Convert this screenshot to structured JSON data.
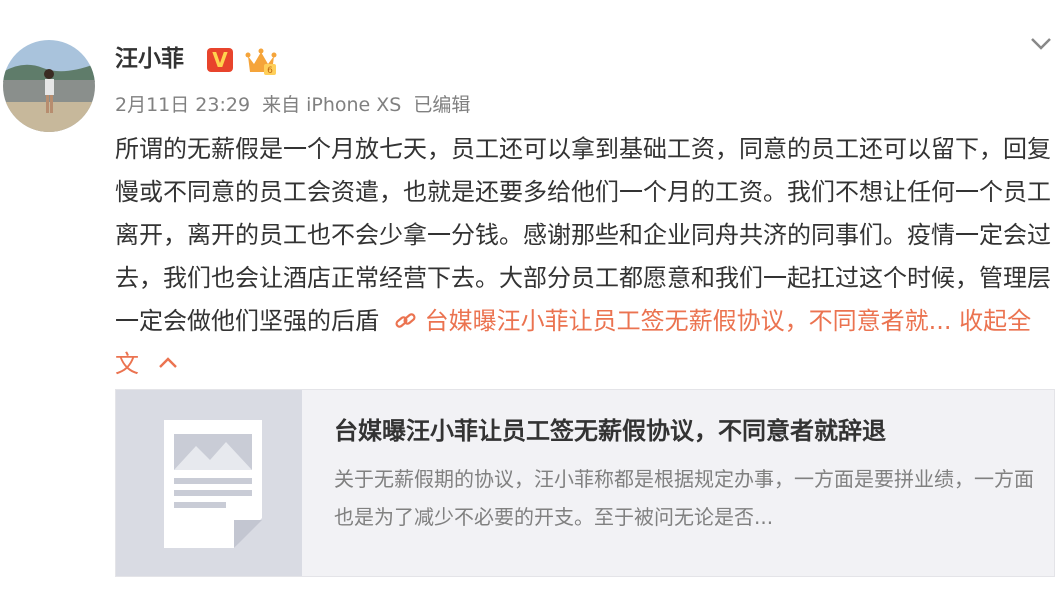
{
  "post": {
    "username": "汪小菲",
    "verified_badge": "V",
    "meta": {
      "date": "2月11日 23:29",
      "source": "来自 iPhone XS",
      "edited": "已编辑"
    },
    "text": "所谓的无薪假是一个月放七天，员工还可以拿到基础工资，同意的员工还可以留下，回复慢或不同意的员工会资遣，也就是还要多给他们一个月的工资。我们不想让任何一个员工离开，离开的员工也不会少拿一分钱。感谢那些和企业同舟共济的同事们。疫情一定会过去，我们也会让酒店正常经营下去。大部分员工都愿意和我们一起扛过这个时候，管理层一定会做他们坚强的后盾",
    "link_text": "台媒曝汪小菲让员工签无薪假协议，不同意者就...",
    "collapse_label": "收起全文",
    "icons": [
      "avatar",
      "verified-icon",
      "crown-badge-icon",
      "chevron-down-icon",
      "link-icon",
      "chevron-up-icon",
      "article-thumbnail-icon"
    ]
  },
  "card": {
    "title": "台媒曝汪小菲让员工签无薪假协议，不同意者就辞退",
    "description": "关于无薪假期的协议，汪小菲称都是根据规定办事，一方面是要拼业绩，一方面也是为了减少不必要的开支。至于被问无论是否..."
  },
  "colors": {
    "accent": "#eb7350",
    "verified": "#e8442c",
    "meta_text": "#808080",
    "card_bg": "#f2f2f5"
  }
}
